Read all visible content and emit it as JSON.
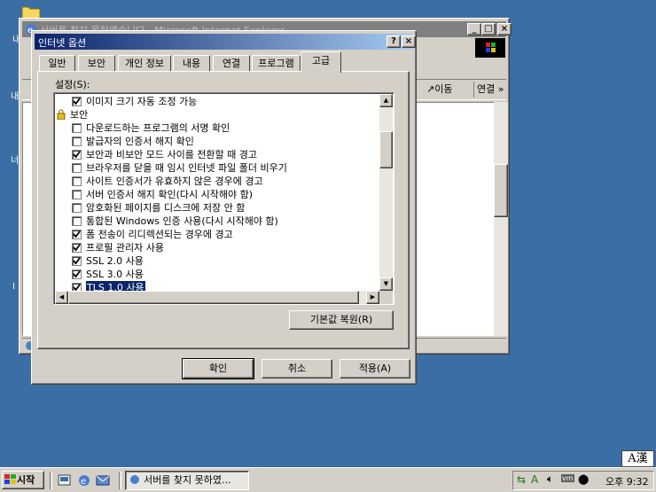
{
  "desktop": {
    "ime_label": "A漢"
  },
  "ie_window": {
    "title": "서버를 찾지 못하였습니다 - Microsoft Internet Explorer",
    "toolbar": {
      "go_label": "이동",
      "links_label": "연결 »"
    }
  },
  "dialog": {
    "title": "인터넷 옵션",
    "help_label": "?",
    "close_label": "×",
    "tabs": [
      {
        "label": "일반"
      },
      {
        "label": "보안"
      },
      {
        "label": "개인 정보"
      },
      {
        "label": "내용"
      },
      {
        "label": "연결"
      },
      {
        "label": "프로그램"
      },
      {
        "label": "고급"
      }
    ],
    "settings_label": "설정(S):",
    "settings": [
      {
        "label": "이미지 크기 자동 조정 가능",
        "checked": true
      },
      {
        "label": "보안",
        "category": true
      },
      {
        "label": "다운로드하는 프로그램의 서명 확인",
        "checked": false
      },
      {
        "label": "발급자의 인증서 해지 확인",
        "checked": false
      },
      {
        "label": "보안과 비보안 모드 사이를 전환할 때 경고",
        "checked": true
      },
      {
        "label": "브라우저를 닫을 때 임시 인터넷 파일 폴더 비우기",
        "checked": false
      },
      {
        "label": "사이트 인증서가 유효하지 않은 경우에 경고",
        "checked": false
      },
      {
        "label": "서버 인증서 해지 확인(다시 시작해야 함)",
        "checked": false
      },
      {
        "label": "암호화된 페이지를 디스크에 저장 안 함",
        "checked": false
      },
      {
        "label": "통합된 Windows 인증 사용(다시 시작해야 함)",
        "checked": false
      },
      {
        "label": "폼 전송이 리디렉션되는 경우에 경고",
        "checked": true
      },
      {
        "label": "프로필 관리자 사용",
        "checked": true
      },
      {
        "label": "SSL 2.0 사용",
        "checked": true
      },
      {
        "label": "SSL 3.0 사용",
        "checked": true
      },
      {
        "label": "TLS 1.0 사용",
        "checked": true,
        "selected": true
      }
    ],
    "restore_defaults_label": "기본값 복원(R)",
    "ok_label": "확인",
    "cancel_label": "취소",
    "apply_label": "적용(A)"
  },
  "taskbar": {
    "start_label": "시작",
    "task_label": "서버를 찾지 못하였...",
    "clock": "오후 9:32"
  }
}
